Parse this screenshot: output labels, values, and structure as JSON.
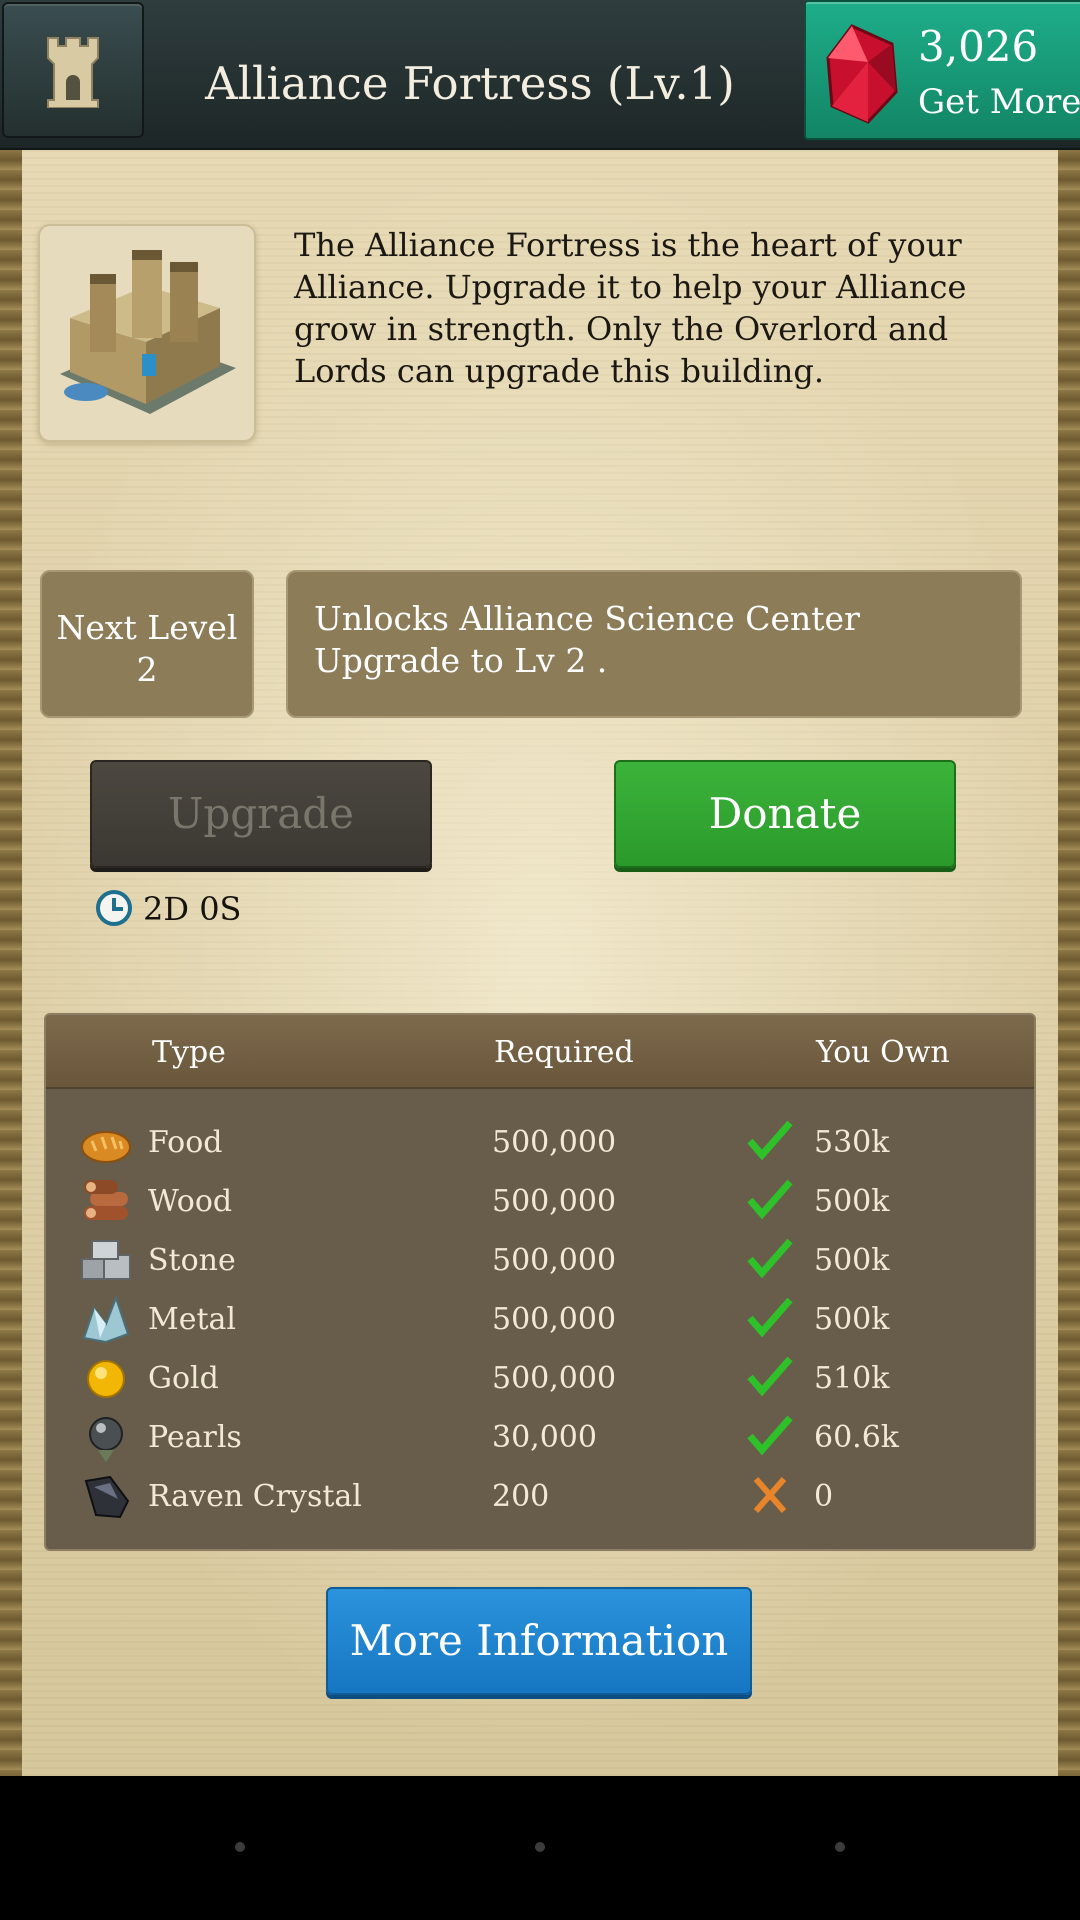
{
  "header": {
    "title": "Alliance Fortress (Lv.1)",
    "gems": "3,026",
    "get_more": "Get More"
  },
  "intro": {
    "description": "The Alliance Fortress is the heart of your Alliance. Upgrade it to help your Alliance grow in strength. Only the Overlord and Lords can upgrade this building."
  },
  "next_level": {
    "label": "Next Level",
    "value": "2",
    "unlock_text": "Unlocks Alliance Science Center Upgrade to Lv 2 ."
  },
  "actions": {
    "upgrade": "Upgrade",
    "donate": "Donate",
    "timer": "2D 0S",
    "more_info": "More Information"
  },
  "table": {
    "headers": {
      "type": "Type",
      "required": "Required",
      "own": "You Own"
    },
    "rows": [
      {
        "icon": "food-icon",
        "name": "Food",
        "required": "500,000",
        "status": "ok",
        "own": "530k"
      },
      {
        "icon": "wood-icon",
        "name": "Wood",
        "required": "500,000",
        "status": "ok",
        "own": "500k"
      },
      {
        "icon": "stone-icon",
        "name": "Stone",
        "required": "500,000",
        "status": "ok",
        "own": "500k"
      },
      {
        "icon": "metal-icon",
        "name": "Metal",
        "required": "500,000",
        "status": "ok",
        "own": "500k"
      },
      {
        "icon": "gold-icon",
        "name": "Gold",
        "required": "500,000",
        "status": "ok",
        "own": "510k"
      },
      {
        "icon": "pearls-icon",
        "name": "Pearls",
        "required": "30,000",
        "status": "ok",
        "own": "60.6k"
      },
      {
        "icon": "raven-crystal-icon",
        "name": "Raven Crystal",
        "required": "200",
        "status": "missing",
        "own": "0"
      }
    ]
  },
  "colors": {
    "check": "#2fc12a",
    "cross": "#e8842a",
    "donate_green": "#2f9e2d",
    "info_blue": "#1a7fcb",
    "gem_teal": "#169776"
  }
}
